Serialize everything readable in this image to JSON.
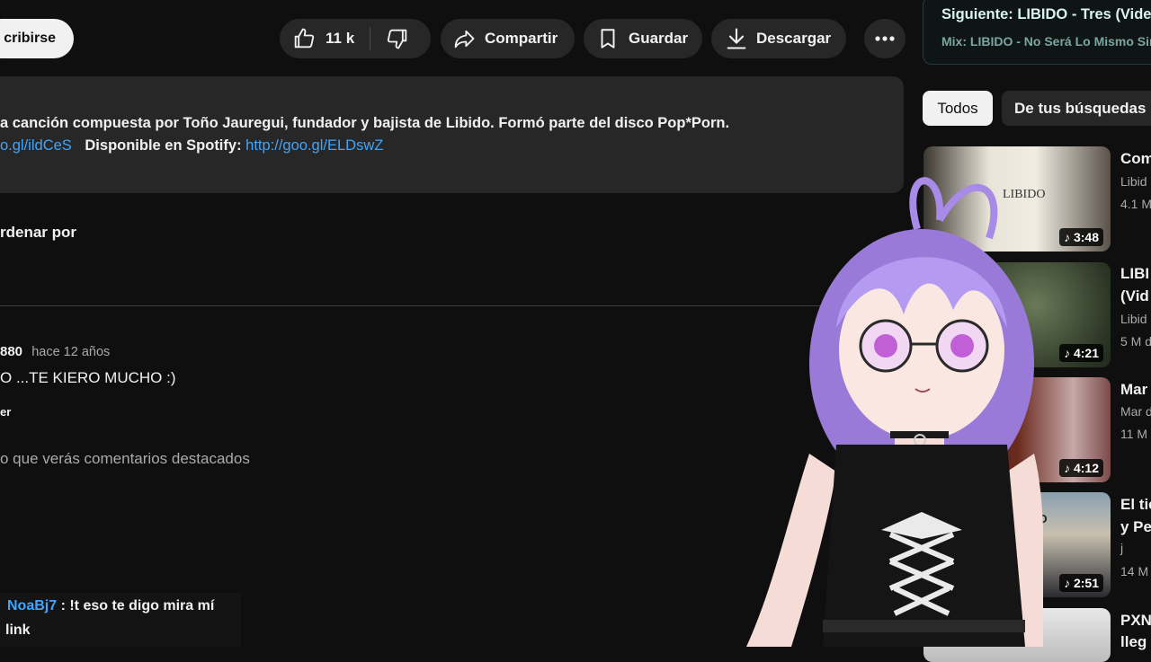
{
  "actions": {
    "subscribe_label": "cribirse",
    "like_count": "11 k",
    "share_label": "Compartir",
    "save_label": "Guardar",
    "download_label": "Descargar"
  },
  "description": {
    "line1": "a canción compuesta por Toño Jauregui, fundador y bajista de Libido. Formó parte del disco Pop*Porn.",
    "link1": "o.gl/ildCeS",
    "spotify_label": "Disponible en Spotify:",
    "spotify_link": "http://goo.gl/ELDswZ"
  },
  "comments": {
    "sort_label": "rdenar por",
    "comment_author": "880",
    "comment_time": "hace 12 años",
    "comment_text": "O ...TE KIERO MUCHO :)",
    "comment_more": "er",
    "notice": "o que verás comentarios destacados"
  },
  "up_next": {
    "next_label": "Siguiente: LIBIDO - Tres (Vide",
    "mix_label": "Mix: LIBIDO - No Será Lo Mismo Sin"
  },
  "filters": [
    "Todos",
    "De tus búsquedas"
  ],
  "videos": [
    {
      "title": "Com",
      "title2": "",
      "channel": "Libid",
      "meta": "4.1 M",
      "duration": "3:48",
      "thumb_text": "LIBIDO"
    },
    {
      "title": "LIBI",
      "title2": "(Vid",
      "channel": "Libid",
      "meta": "5 M d",
      "duration": "4:21",
      "thumb_text": ""
    },
    {
      "title": "Mar",
      "title2": "",
      "channel": "Mar d",
      "meta": "11 M",
      "duration": "4:12",
      "thumb_text": ""
    },
    {
      "title": "El tie",
      "title2": "y Pe",
      "channel": "j",
      "meta": "14 M",
      "duration": "2:51",
      "thumb_text": "MPO"
    },
    {
      "title": "PXN",
      "title2": "lleg",
      "channel": "",
      "meta": "",
      "duration": "",
      "thumb_text": ""
    }
  ],
  "chat": {
    "username": "NoaBj7",
    "message": ": !t eso te digo mira mí",
    "message2": "link"
  },
  "colors": {
    "background": "#0f0f0f",
    "surface": "#272727",
    "link": "#3ea6ff",
    "avatar_hair": "#a78be6"
  }
}
